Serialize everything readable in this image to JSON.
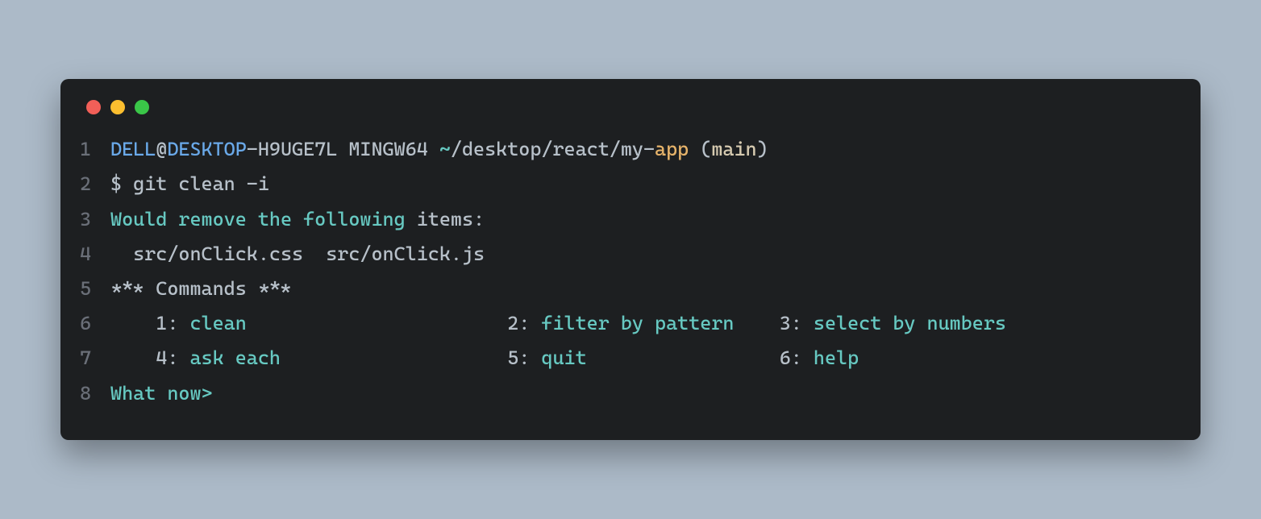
{
  "lineNumbers": [
    "1",
    "2",
    "3",
    "4",
    "5",
    "6",
    "7",
    "8"
  ],
  "line1": {
    "user": "DELL",
    "at": "@",
    "host": "DESKTOP",
    "dash": "-",
    "hostSuffix": "H9UGE7L MINGW64 ",
    "tilde": "~",
    "pathRest": "/desktop/react/my-",
    "appWord": "app",
    "space": " ",
    "paren1": "(",
    "branch": "main",
    "paren2": ")"
  },
  "line2": "$ git clean -i",
  "line3": {
    "prefix": "Would remove the following",
    "suffix": " items:"
  },
  "line4": "  src/onClick.css  src/onClick.js",
  "line5": "*** Commands ***",
  "line6": {
    "n1": "    1: ",
    "cmd1": "clean",
    "gap1": "                       ",
    "n2": "2: ",
    "cmd2": "filter by pattern",
    "gap2": "    ",
    "n3": "3: ",
    "cmd3": "select by numbers"
  },
  "line7": {
    "n4": "    4: ",
    "cmd4": "ask each",
    "gap1": "                    ",
    "n5": "5: ",
    "cmd5": "quit",
    "gap2": "                 ",
    "n6": "6: ",
    "cmd6": "help"
  },
  "line8": "What now> "
}
